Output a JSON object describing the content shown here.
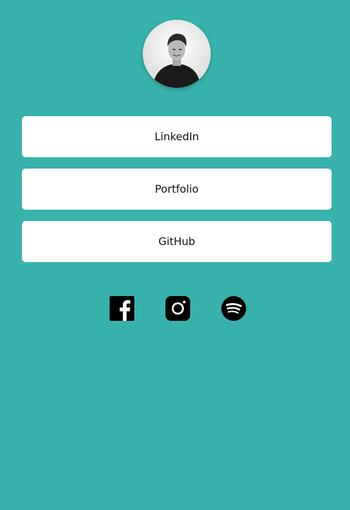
{
  "profile": {
    "avatar_icon": "person-photo"
  },
  "links": [
    {
      "label": "LinkedIn"
    },
    {
      "label": "Portfolio"
    },
    {
      "label": "GitHub"
    }
  ],
  "social": [
    {
      "name": "facebook",
      "icon": "facebook-icon"
    },
    {
      "name": "instagram",
      "icon": "instagram-icon"
    },
    {
      "name": "spotify",
      "icon": "spotify-icon"
    }
  ],
  "colors": {
    "background": "#37b2ac",
    "button_bg": "#ffffff",
    "text": "#111111",
    "icon": "#000000"
  }
}
